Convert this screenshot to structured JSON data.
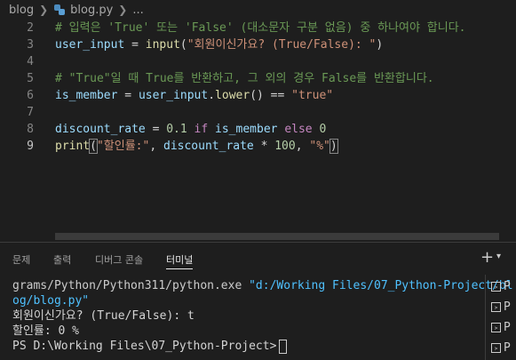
{
  "breadcrumb": {
    "folder": "blog",
    "file": "blog.py",
    "symbol": "..."
  },
  "editor": {
    "lines": [
      {
        "n": "2",
        "tokens": [
          {
            "t": "# 입력은 'True' 또는 'False' (대소문자 구분 없음) 중 하나여야 합니다.",
            "c": "cmt"
          }
        ]
      },
      {
        "n": "3",
        "tokens": [
          {
            "t": "user_input",
            "c": "var"
          },
          {
            "t": " = ",
            "c": "op"
          },
          {
            "t": "input",
            "c": "fn"
          },
          {
            "t": "(",
            "c": "op"
          },
          {
            "t": "\"회원이신가요? (True/False): \"",
            "c": "str"
          },
          {
            "t": ")",
            "c": "op"
          }
        ]
      },
      {
        "n": "4",
        "tokens": []
      },
      {
        "n": "5",
        "tokens": [
          {
            "t": "# \"True\"일 때 True를 반환하고, 그 외의 경우 False를 반환합니다.",
            "c": "cmt"
          }
        ]
      },
      {
        "n": "6",
        "tokens": [
          {
            "t": "is_member",
            "c": "var"
          },
          {
            "t": " = ",
            "c": "op"
          },
          {
            "t": "user_input",
            "c": "var"
          },
          {
            "t": ".",
            "c": "op"
          },
          {
            "t": "lower",
            "c": "fn"
          },
          {
            "t": "() == ",
            "c": "op"
          },
          {
            "t": "\"true\"",
            "c": "str"
          }
        ]
      },
      {
        "n": "7",
        "tokens": []
      },
      {
        "n": "8",
        "tokens": [
          {
            "t": "discount_rate",
            "c": "var"
          },
          {
            "t": " = ",
            "c": "op"
          },
          {
            "t": "0.1",
            "c": "num"
          },
          {
            "t": " ",
            "c": "op"
          },
          {
            "t": "if",
            "c": "kw"
          },
          {
            "t": " ",
            "c": "op"
          },
          {
            "t": "is_member",
            "c": "var"
          },
          {
            "t": " ",
            "c": "op"
          },
          {
            "t": "else",
            "c": "kw"
          },
          {
            "t": " ",
            "c": "op"
          },
          {
            "t": "0",
            "c": "num"
          }
        ]
      },
      {
        "n": "9",
        "tokens": [
          {
            "t": "print",
            "c": "fn"
          },
          {
            "t": "(",
            "c": "op brk-match"
          },
          {
            "t": "\"할인률:\"",
            "c": "str"
          },
          {
            "t": ", ",
            "c": "op"
          },
          {
            "t": "discount_rate",
            "c": "var"
          },
          {
            "t": " * ",
            "c": "op"
          },
          {
            "t": "100",
            "c": "num"
          },
          {
            "t": ", ",
            "c": "op"
          },
          {
            "t": "\"%\"",
            "c": "str"
          },
          {
            "t": ")",
            "c": "op brk-match"
          }
        ]
      }
    ]
  },
  "panel": {
    "tabs": [
      "문제",
      "출력",
      "디버그 콘솔",
      "터미널"
    ],
    "active_tab": "터미널",
    "add_label": "+",
    "terminal": {
      "line1_path": "grams/Python/Python311/python.exe",
      "line1_arg": "\"d:/Working Files/07_Python-Project/bl",
      "line2_arg": "og/blog.py\"",
      "line3": "회원이신가요? (True/False): t",
      "line4": "할인률: 0 %",
      "prompt": "PS D:\\Working Files\\07_Python-Project>"
    },
    "side_items": [
      "P",
      "P",
      "P",
      "P"
    ]
  }
}
